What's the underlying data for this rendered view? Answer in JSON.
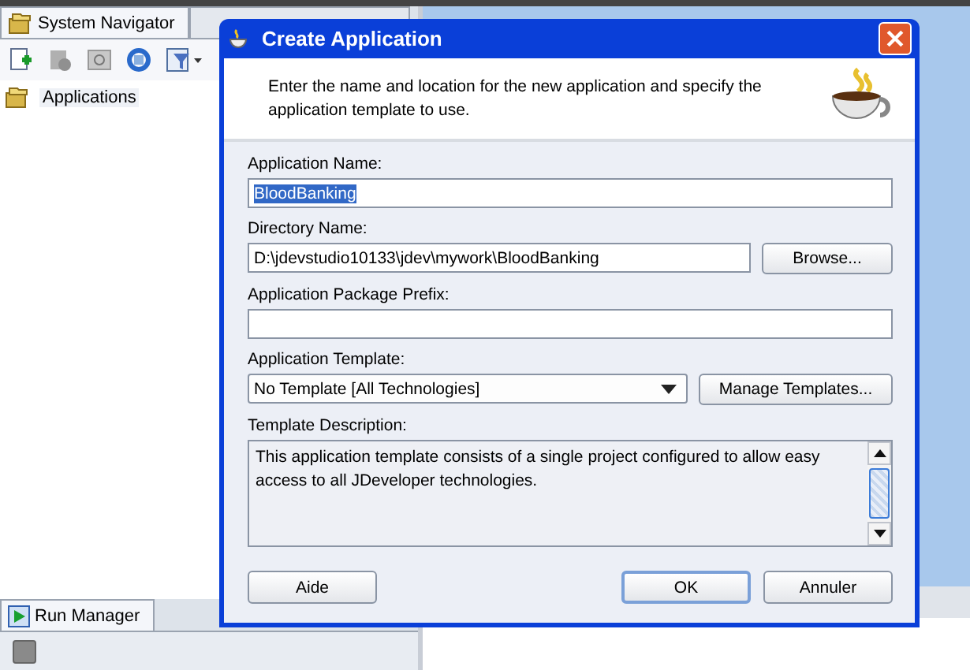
{
  "navigator": {
    "tabs": [
      {
        "label": "System Navigator",
        "selected": true
      }
    ],
    "tree": [
      {
        "label": "Applications",
        "selected": false
      }
    ]
  },
  "run_manager": {
    "tabs": [
      {
        "label": "Run Manager",
        "selected": true
      }
    ]
  },
  "dialog": {
    "title": "Create Application",
    "instructions": "Enter the name and location for the new application and specify the application template to use.",
    "fields": [
      {
        "kind": "text",
        "label": "Application Name:",
        "value": "BloodBanking",
        "value_selected": true
      },
      {
        "kind": "text",
        "label": "Directory Name:",
        "value": "D:\\jdevstudio10133\\jdev\\mywork\\BloodBanking",
        "button": "Browse..."
      },
      {
        "kind": "text",
        "label": "Application Package Prefix:"
      },
      {
        "kind": "combo",
        "label": "Application Template:",
        "value": "No Template [All Technologies]",
        "button": "Manage Templates..."
      },
      {
        "kind": "textarea",
        "label": "Template Description:",
        "value": "This application template consists of a single project configured to allow easy access to all JDeveloper technologies."
      }
    ],
    "buttons": [
      {
        "label": "Aide",
        "default": false
      },
      {
        "label": "OK",
        "default": true
      },
      {
        "label": "Annuler",
        "default": false
      }
    ]
  }
}
